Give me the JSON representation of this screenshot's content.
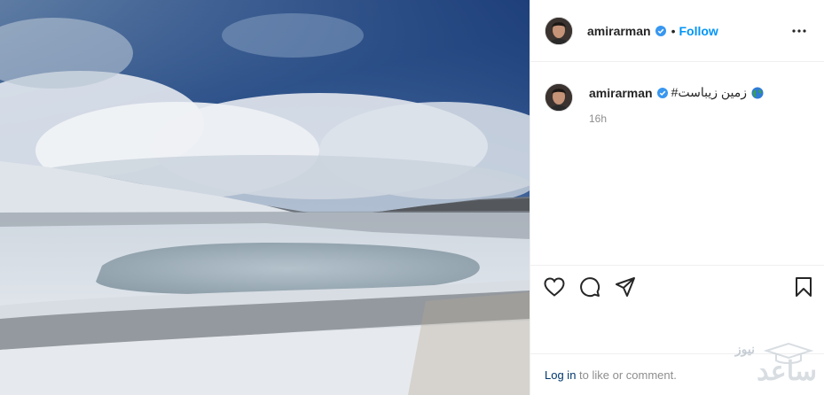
{
  "post": {
    "author": "amirarman",
    "follow_label": "Follow",
    "separator": "•",
    "caption": {
      "username": "amirarman",
      "text": "زمین زیباست#",
      "emoji_icon": "globe-icon"
    },
    "time": "16h",
    "login_link": "Log in",
    "login_rest": " to like or comment."
  },
  "watermark": {
    "line1": "نیوز",
    "line2": "ساعد"
  },
  "colors": {
    "accent": "#0095f6",
    "verified": "#3897f0",
    "muted": "#8e8e8e",
    "link": "#00376b"
  }
}
